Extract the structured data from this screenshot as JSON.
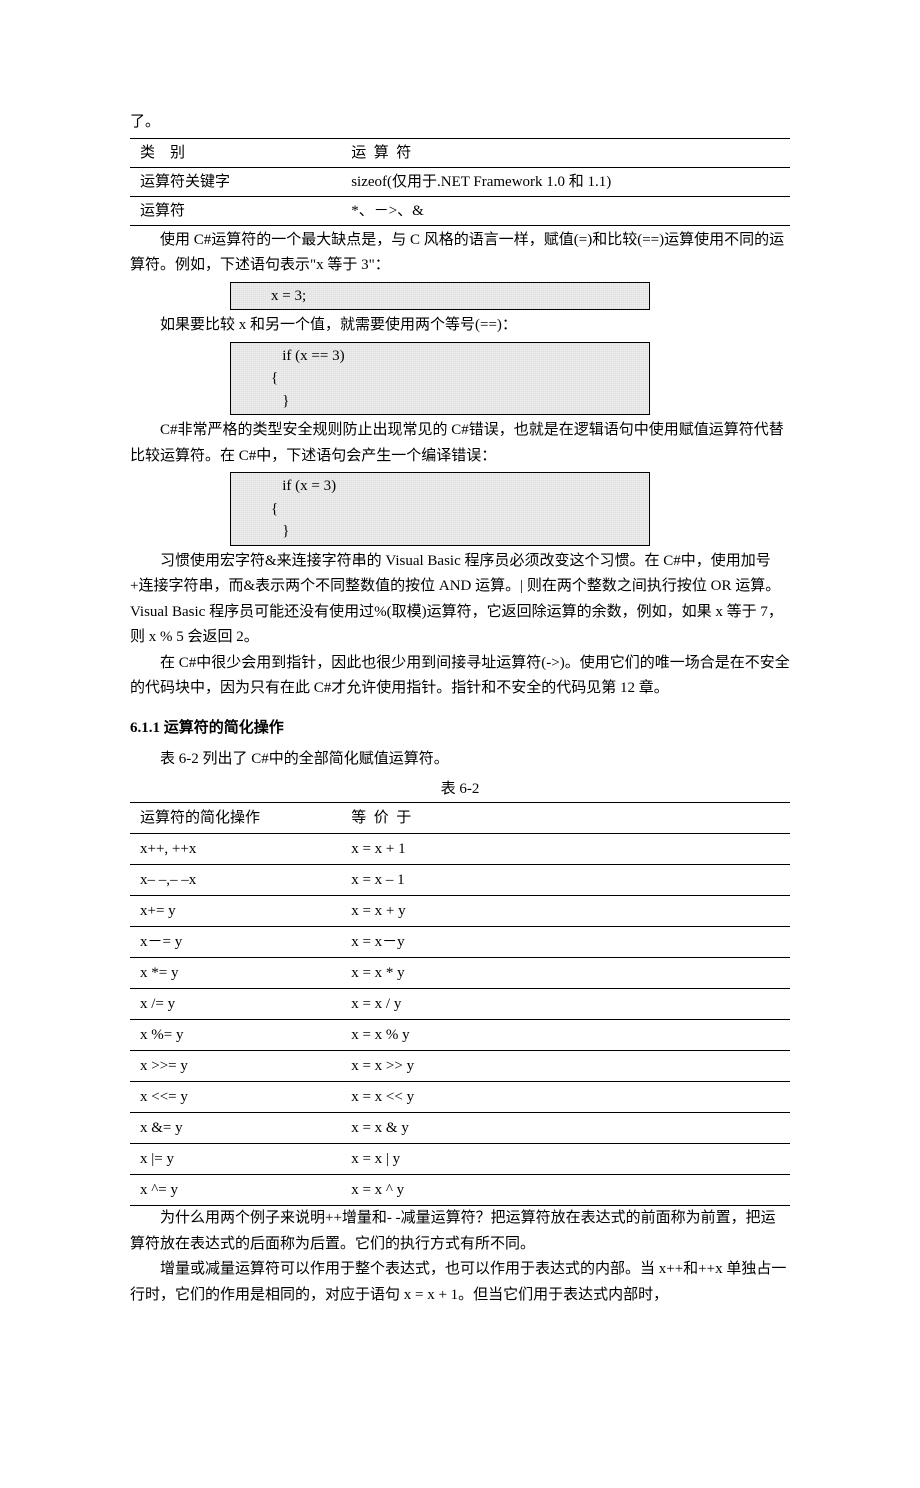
{
  "p0": "了。",
  "table1": {
    "r1c1": "类",
    "r1c1b": "别",
    "r1c2": "运",
    "r1c2b": "算",
    "r1c2c": "符",
    "r2c1": "运算符关键字",
    "r2c2": "sizeof(仅用于.NET Framework 1.0 和 1.1)",
    "r3c1": "运算符",
    "r3c2": "*、－>、&"
  },
  "p1": "使用 C#运算符的一个最大缺点是，与 C 风格的语言一样，赋值(=)和比较(==)运算使用不同的运算符。例如，下述语句表示\"x 等于 3\"：",
  "code1": "x = 3;",
  "p2": "如果要比较 x 和另一个值，就需要使用两个等号(==)：",
  "code2": "   if (x == 3)\n{\n   }",
  "p3": "C#非常严格的类型安全规则防止出现常见的 C#错误，也就是在逻辑语句中使用赋值运算符代替比较运算符。在 C#中，下述语句会产生一个编译错误：",
  "code3": "   if (x = 3)\n{\n   }",
  "p4": "习惯使用宏字符&来连接字符串的 Visual Basic 程序员必须改变这个习惯。在 C#中，使用加号+连接字符串，而&表示两个不同整数值的按位 AND 运算。| 则在两个整数之间执行按位 OR 运算。Visual Basic 程序员可能还没有使用过%(取模)运算符，它返回除运算的余数，例如，如果 x 等于 7，则 x % 5 会返回 2。",
  "p5": "在 C#中很少会用到指针，因此也很少用到间接寻址运算符(->)。使用它们的唯一场合是在不安全的代码块中，因为只有在此 C#才允许使用指针。指针和不安全的代码见第 12 章。",
  "sect_title": "6.1.1  运算符的简化操作",
  "p6": "表 6-2 列出了 C#中的全部简化赋值运算符。",
  "table2_caption": "表  6-2",
  "table2": {
    "hdr1": "运算符的简化操作",
    "hdr2a": "等",
    "hdr2b": "价",
    "hdr2c": "于",
    "rows": [
      [
        "x++, ++x",
        "x = x + 1"
      ],
      [
        "x– –,– –x",
        "x = x – 1"
      ],
      [
        "x+= y",
        "x = x + y"
      ],
      [
        "x－= y",
        "x = x－y"
      ],
      [
        "x *= y",
        "x = x * y"
      ],
      [
        "x /= y",
        "x = x / y"
      ],
      [
        "x %= y",
        "x = x % y"
      ],
      [
        "x >>= y",
        "x = x >> y"
      ],
      [
        "x <<= y",
        "x = x << y"
      ],
      [
        "x &= y",
        "x = x & y"
      ],
      [
        "x |= y",
        "x = x | y"
      ],
      [
        "x ^= y",
        "x = x ^ y"
      ]
    ]
  },
  "p7": "为什么用两个例子来说明++增量和- -减量运算符？把运算符放在表达式的前面称为前置，把运算符放在表达式的后面称为后置。它们的执行方式有所不同。",
  "p8": "增量或减量运算符可以作用于整个表达式，也可以作用于表达式的内部。当 x++和++x 单独占一行时，它们的作用是相同的，对应于语句 x = x + 1。但当它们用于表达式内部时，"
}
